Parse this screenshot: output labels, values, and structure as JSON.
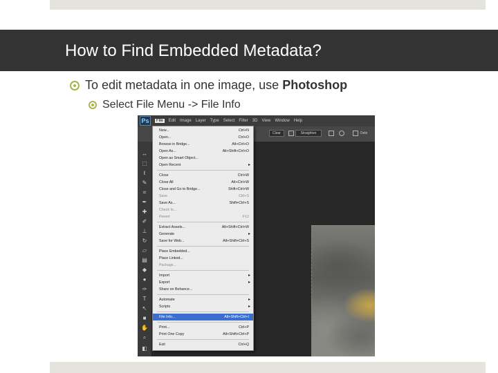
{
  "slide": {
    "title": "How to Find Embedded Metadata?",
    "bullet1_prefix": "To edit metadata in one image, use ",
    "bullet1_bold": "Photoshop",
    "bullet2": "Select File Menu -> File Info"
  },
  "colors": {
    "title_bar": "#333333",
    "bullet_accent": "#a8b34c",
    "menu_highlight": "#3a6fd0"
  },
  "photoshop": {
    "logo": "Ps",
    "menubar": [
      "File",
      "Edit",
      "Image",
      "Layer",
      "Type",
      "Select",
      "Filter",
      "3D",
      "View",
      "Window",
      "Help"
    ],
    "options": {
      "clear": "Clear",
      "straighten": "Straighten",
      "delete": "Dele"
    },
    "file_menu": [
      {
        "label": "New...",
        "shortcut": "Ctrl+N"
      },
      {
        "label": "Open...",
        "shortcut": "Ctrl+O"
      },
      {
        "label": "Browse in Bridge...",
        "shortcut": "Alt+Ctrl+O"
      },
      {
        "label": "Open As...",
        "shortcut": "Alt+Shift+Ctrl+O"
      },
      {
        "label": "Open as Smart Object...",
        "shortcut": ""
      },
      {
        "label": "Open Recent",
        "shortcut": ""
      },
      {
        "label": "Close",
        "shortcut": "Ctrl+W"
      },
      {
        "label": "Close All",
        "shortcut": "Alt+Ctrl+W"
      },
      {
        "label": "Close and Go to Bridge...",
        "shortcut": "Shift+Ctrl+W"
      },
      {
        "label": "Save",
        "shortcut": "Ctrl+S"
      },
      {
        "label": "Save As...",
        "shortcut": "Shift+Ctrl+S"
      },
      {
        "label": "Check In...",
        "shortcut": ""
      },
      {
        "label": "Revert",
        "shortcut": "F12"
      },
      {
        "label": "Extract Assets...",
        "shortcut": "Alt+Shift+Ctrl+W"
      },
      {
        "label": "Generate",
        "shortcut": ""
      },
      {
        "label": "Save for Web...",
        "shortcut": "Alt+Shift+Ctrl+S"
      },
      {
        "label": "Place Embedded...",
        "shortcut": ""
      },
      {
        "label": "Place Linked...",
        "shortcut": ""
      },
      {
        "label": "Package...",
        "shortcut": ""
      },
      {
        "label": "Import",
        "shortcut": ""
      },
      {
        "label": "Export",
        "shortcut": ""
      },
      {
        "label": "Share on Behance...",
        "shortcut": ""
      },
      {
        "label": "Automate",
        "shortcut": ""
      },
      {
        "label": "Scripts",
        "shortcut": ""
      },
      {
        "label": "File Info...",
        "shortcut": "Alt+Shift+Ctrl+I"
      },
      {
        "label": "Print...",
        "shortcut": "Ctrl+P"
      },
      {
        "label": "Print One Copy",
        "shortcut": "Alt+Shift+Ctrl+P"
      },
      {
        "label": "Exit",
        "shortcut": "Ctrl+Q"
      }
    ]
  }
}
